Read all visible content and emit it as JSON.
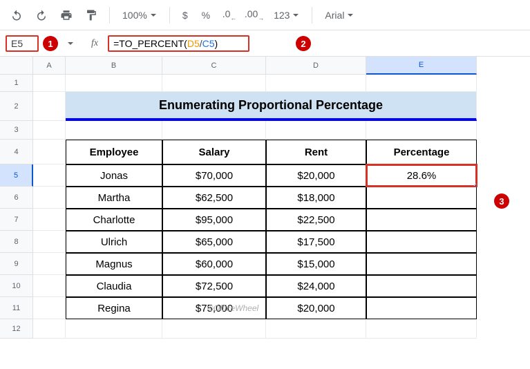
{
  "toolbar": {
    "zoom": "100%",
    "currency": "$",
    "percent": "%",
    "number_format": "123",
    "font": "Arial"
  },
  "formulaBar": {
    "cellRef": "E5",
    "formula": "=TO_PERCENT(D5/C5)",
    "funcName": "=TO_PERCENT",
    "ref1": "D5",
    "ref2": "C5"
  },
  "columns": [
    "A",
    "B",
    "C",
    "D",
    "E"
  ],
  "rows": [
    "1",
    "2",
    "3",
    "4",
    "5",
    "6",
    "7",
    "8",
    "9",
    "10",
    "11",
    "12"
  ],
  "colWidths": {
    "A": 47,
    "B": 140,
    "C": 150,
    "D": 145,
    "E": 160
  },
  "rowHeights": {
    "default": 32,
    "r1": 25,
    "r2": 42,
    "r3": 27,
    "r4": 36,
    "r12": 28
  },
  "title": "Enumerating Proportional Percentage",
  "headers": {
    "employee": "Employee",
    "salary": "Salary",
    "rent": "Rent",
    "percentage": "Percentage"
  },
  "data": [
    {
      "employee": "Jonas",
      "salary": "$70,000",
      "rent": "$20,000",
      "percentage": "28.6%"
    },
    {
      "employee": "Martha",
      "salary": "$62,500",
      "rent": "$18,000",
      "percentage": ""
    },
    {
      "employee": "Charlotte",
      "salary": "$95,000",
      "rent": "$22,500",
      "percentage": ""
    },
    {
      "employee": "Ulrich",
      "salary": "$65,000",
      "rent": "$17,500",
      "percentage": ""
    },
    {
      "employee": "Magnus",
      "salary": "$60,000",
      "rent": "$15,000",
      "percentage": ""
    },
    {
      "employee": "Claudia",
      "salary": "$72,500",
      "rent": "$24,000",
      "percentage": ""
    },
    {
      "employee": "Regina",
      "salary": "$75,000",
      "rent": "$20,000",
      "percentage": ""
    }
  ],
  "annotations": {
    "a1": "1",
    "a2": "2",
    "a3": "3"
  },
  "watermark": "©OfficeWheel",
  "selectedCell": "E5",
  "selectedCol": "E",
  "selectedRow": "5"
}
